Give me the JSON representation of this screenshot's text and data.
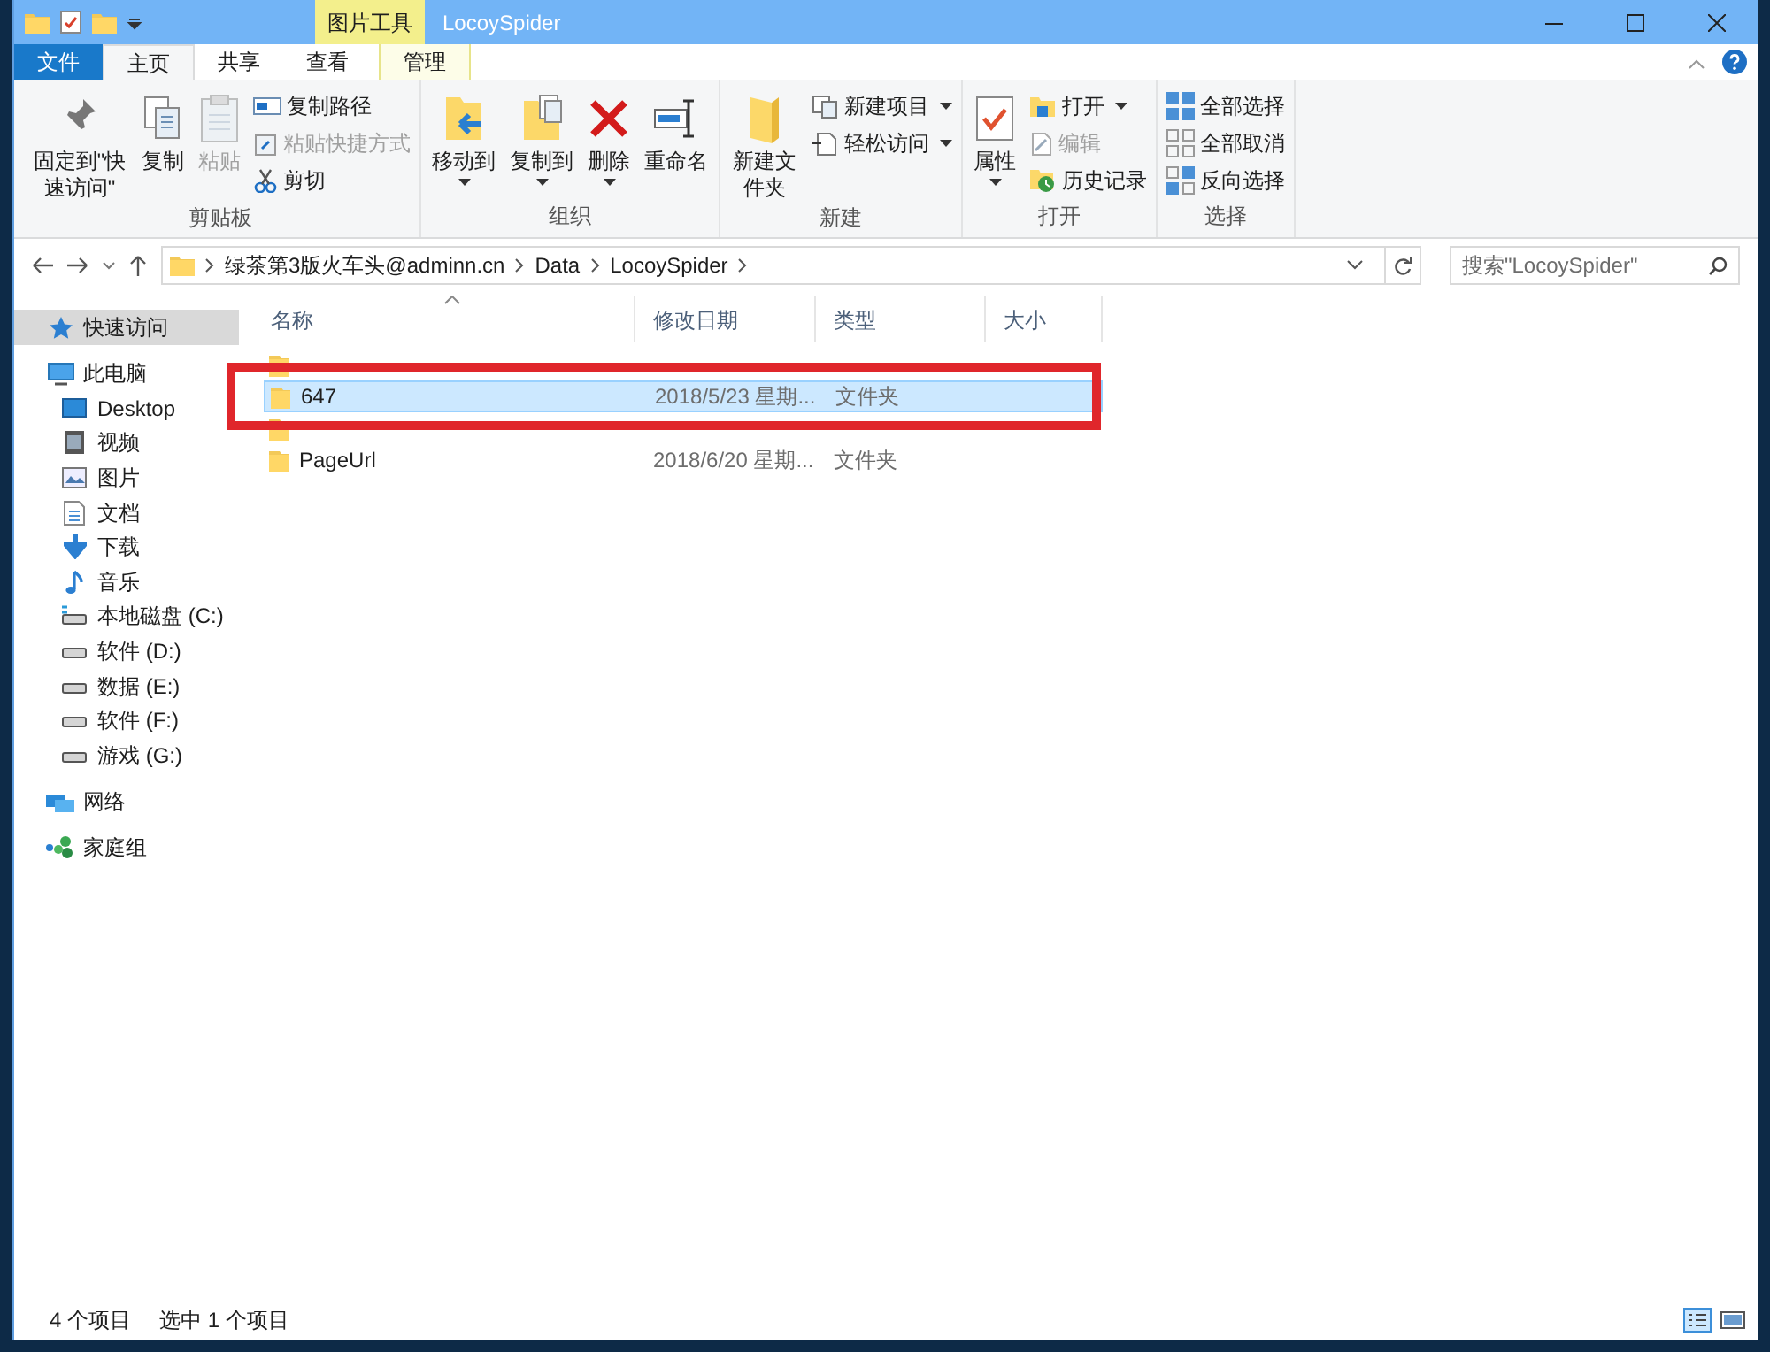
{
  "title_bar": {
    "context_tab": "图片工具",
    "title": "LocoySpider"
  },
  "ribbon_tabs": [
    {
      "label": "文件",
      "kind": "file",
      "selected": false
    },
    {
      "label": "主页",
      "kind": "tab",
      "selected": true
    },
    {
      "label": "共享",
      "kind": "tab",
      "selected": false
    },
    {
      "label": "查看",
      "kind": "tab",
      "selected": false
    },
    {
      "label": "管理",
      "kind": "context",
      "selected": false
    }
  ],
  "ribbon_groups": [
    {
      "label": "剪贴板",
      "items": [
        {
          "label": "固定到\"快速访问\"",
          "kind": "large",
          "disabled": false,
          "dropdown": false
        },
        {
          "label": "复制",
          "kind": "large",
          "disabled": false,
          "dropdown": false
        },
        {
          "label": "粘贴",
          "kind": "large",
          "disabled": true,
          "dropdown": false
        },
        {
          "label": "复制路径",
          "kind": "small",
          "disabled": false,
          "dropdown": false
        },
        {
          "label": "粘贴快捷方式",
          "kind": "small",
          "disabled": true,
          "dropdown": false
        },
        {
          "label": "剪切",
          "kind": "small",
          "disabled": false,
          "dropdown": false
        }
      ]
    },
    {
      "label": "组织",
      "items": [
        {
          "label": "移动到",
          "kind": "large",
          "disabled": false,
          "dropdown": true
        },
        {
          "label": "复制到",
          "kind": "large",
          "disabled": false,
          "dropdown": true
        },
        {
          "label": "删除",
          "kind": "large",
          "disabled": false,
          "dropdown": true
        },
        {
          "label": "重命名",
          "kind": "large",
          "disabled": false,
          "dropdown": false
        }
      ]
    },
    {
      "label": "新建",
      "items": [
        {
          "label": "新建文件夹",
          "kind": "large",
          "disabled": false,
          "dropdown": false
        },
        {
          "label": "新建项目",
          "kind": "small",
          "disabled": false,
          "dropdown": true
        },
        {
          "label": "轻松访问",
          "kind": "small",
          "disabled": false,
          "dropdown": true
        }
      ]
    },
    {
      "label": "打开",
      "items": [
        {
          "label": "属性",
          "kind": "large",
          "disabled": false,
          "dropdown": true
        },
        {
          "label": "打开",
          "kind": "small",
          "disabled": false,
          "dropdown": true
        },
        {
          "label": "编辑",
          "kind": "small",
          "disabled": true,
          "dropdown": false
        },
        {
          "label": "历史记录",
          "kind": "small",
          "disabled": false,
          "dropdown": false
        }
      ]
    },
    {
      "label": "选择",
      "items": [
        {
          "label": "全部选择",
          "kind": "small",
          "disabled": false,
          "dropdown": false
        },
        {
          "label": "全部取消",
          "kind": "small",
          "disabled": false,
          "dropdown": false
        },
        {
          "label": "反向选择",
          "kind": "small",
          "disabled": false,
          "dropdown": false
        }
      ]
    }
  ],
  "address_bar": {
    "segments": [
      "绿茶第3版火车头@adminn.cn",
      "Data",
      "LocoySpider"
    ]
  },
  "search": {
    "placeholder": "搜索\"LocoySpider\""
  },
  "sidebar": {
    "items": [
      {
        "label": "快速访问",
        "selected": true
      },
      {
        "label": "此电脑",
        "selected": false,
        "children": [
          {
            "label": "Desktop",
            "selected": false
          },
          {
            "label": "视频",
            "selected": false
          },
          {
            "label": "图片",
            "selected": false
          },
          {
            "label": "文档",
            "selected": false
          },
          {
            "label": "下载",
            "selected": false
          },
          {
            "label": "音乐",
            "selected": false
          },
          {
            "label": "本地磁盘 (C:)",
            "selected": false
          },
          {
            "label": "软件 (D:)",
            "selected": false
          },
          {
            "label": "数据 (E:)",
            "selected": false
          },
          {
            "label": "软件 (F:)",
            "selected": false
          },
          {
            "label": "游戏 (G:)",
            "selected": false
          }
        ]
      },
      {
        "label": "网络",
        "selected": false
      },
      {
        "label": "家庭组",
        "selected": false
      }
    ]
  },
  "file_list": {
    "columns": [
      "名称",
      "修改日期",
      "类型",
      "大小"
    ],
    "rows": [
      {
        "selected": false,
        "boxed": false
      },
      {
        "name": "647",
        "date": "2018/5/23 星期...",
        "type": "文件夹",
        "selected": true,
        "boxed": true
      },
      {
        "selected": false,
        "boxed": false
      },
      {
        "name": "PageUrl",
        "date": "2018/6/20 星期...",
        "type": "文件夹",
        "selected": false,
        "boxed": false
      }
    ]
  },
  "status_bar": [
    "4 个项目",
    "选中 1 个项目"
  ]
}
